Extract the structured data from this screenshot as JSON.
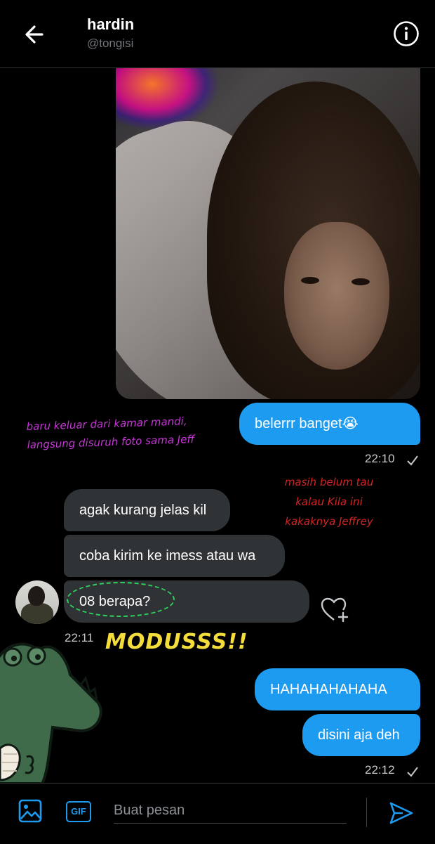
{
  "header": {
    "name": "hardin",
    "handle": "@tongisi",
    "back_icon": "arrow-left-icon",
    "info_icon": "info-icon"
  },
  "messages": {
    "sent_1": {
      "text": "belerrr banget😭",
      "time": "22:10"
    },
    "received": [
      {
        "text": "agak kurang jelas kil"
      },
      {
        "text": "coba kirim ke imess atau wa"
      },
      {
        "text": "08 berapa?"
      }
    ],
    "received_time": "22:11",
    "sent_2": {
      "texts": [
        "HAHAHAHAHAHA",
        "disini aja deh"
      ],
      "time": "22:12"
    }
  },
  "annotations": {
    "purple": [
      "baru keluar dari kamar mandi,",
      "langsung disuruh foto sama Jeff"
    ],
    "red": [
      "masih belum tau",
      "kalau Kila ini",
      "kakaknya Jeffrey"
    ],
    "yellow": "MODUSSS!!"
  },
  "composer": {
    "placeholder": "Buat pesan",
    "gif_label": "GIF",
    "image_icon": "image-icon",
    "send_icon": "send-icon"
  },
  "colors": {
    "accent": "#1d9bf0",
    "incoming_bubble": "#2f3336",
    "background": "#000000"
  }
}
